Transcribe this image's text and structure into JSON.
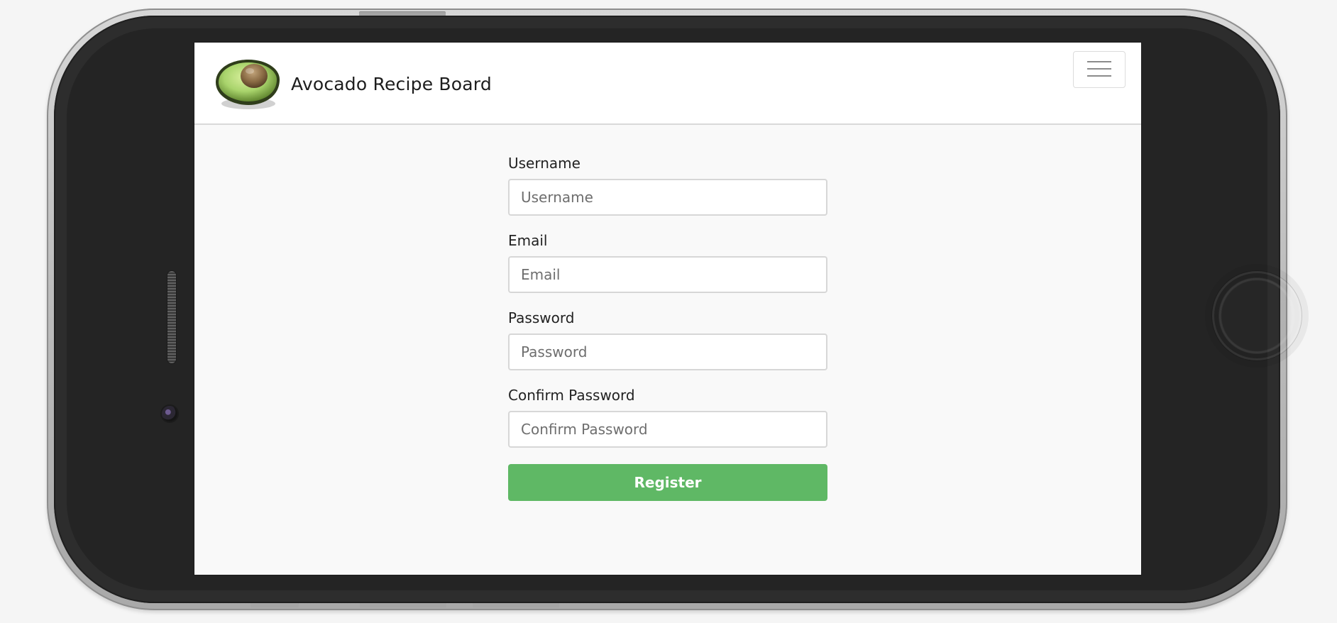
{
  "app": {
    "brand_title": "Avocado Recipe Board"
  },
  "icons": {
    "logo": "avocado-icon",
    "menu": "hamburger-menu-icon"
  },
  "form": {
    "fields": [
      {
        "label": "Username",
        "placeholder": "Username",
        "value": ""
      },
      {
        "label": "Email",
        "placeholder": "Email",
        "value": ""
      },
      {
        "label": "Password",
        "placeholder": "Password",
        "value": ""
      },
      {
        "label": "Confirm Password",
        "placeholder": "Confirm Password",
        "value": ""
      }
    ],
    "submit_label": "Register"
  },
  "colors": {
    "accent": "#5fb865",
    "screen_bg": "#f9f9f9",
    "navbar_bg": "#ffffff",
    "phone_bezel": "#242424",
    "phone_frame": "#bdbdbd"
  }
}
